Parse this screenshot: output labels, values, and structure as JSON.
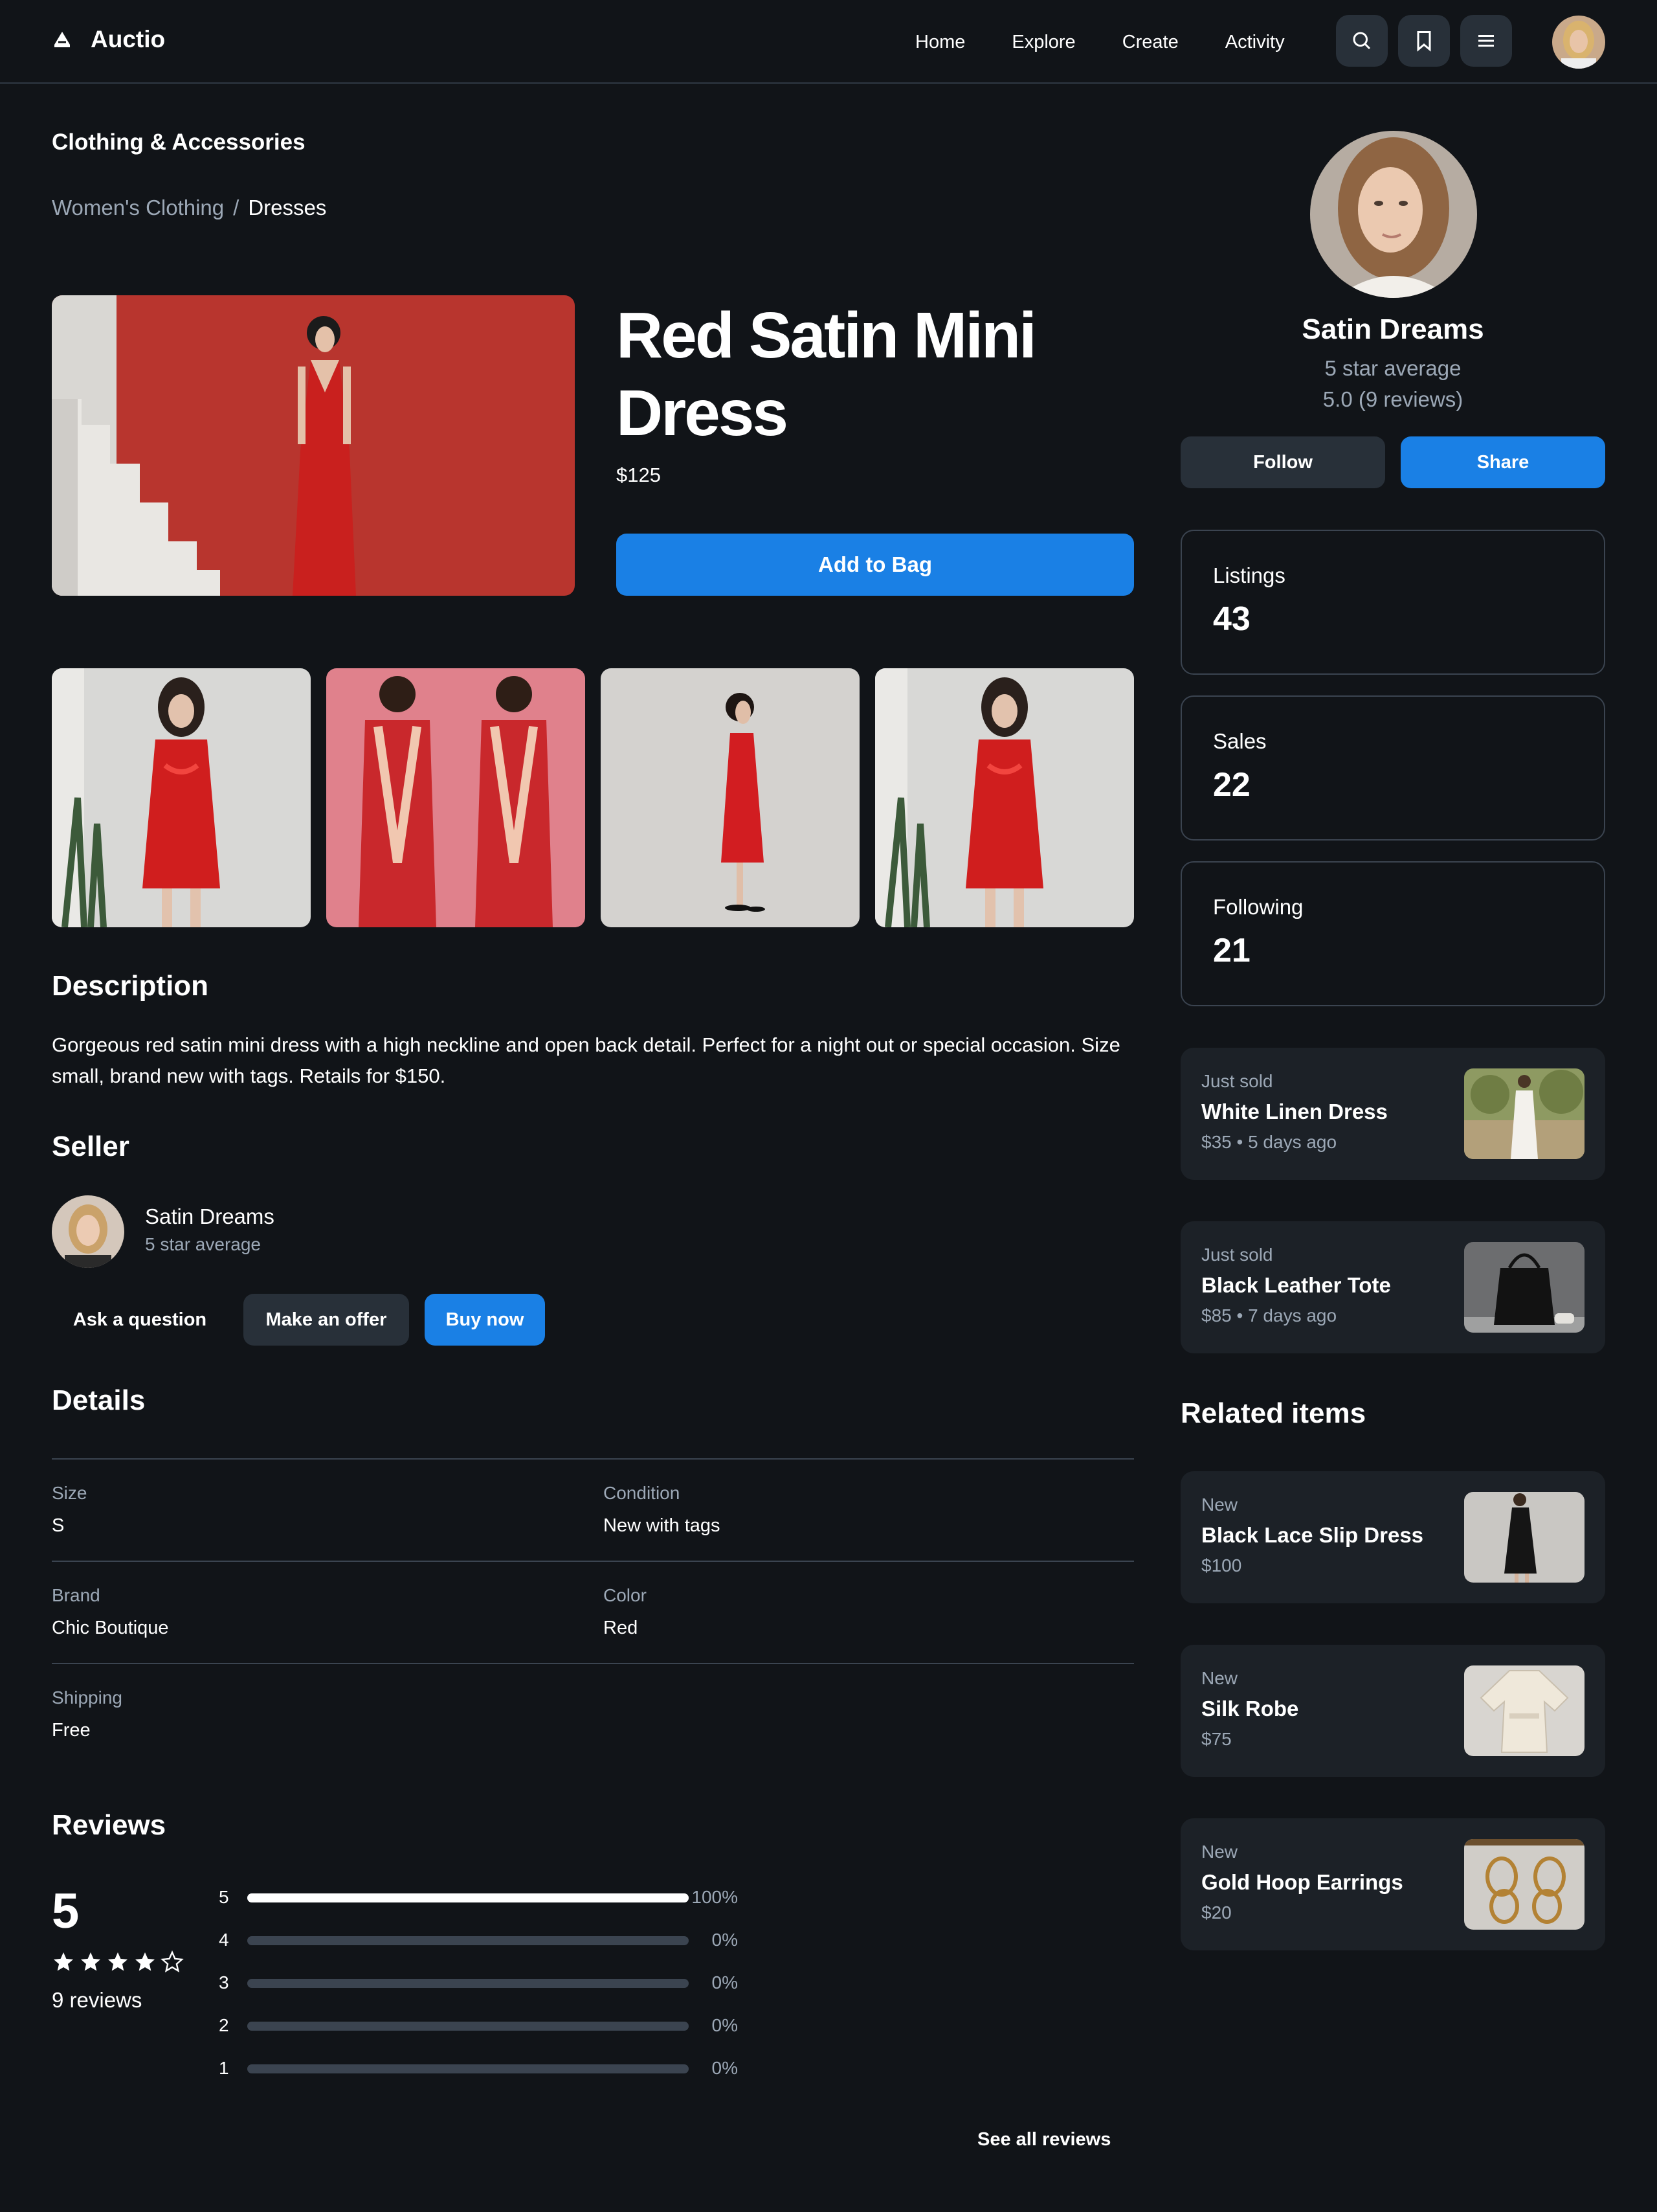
{
  "header": {
    "app_name": "Auctio",
    "nav": [
      "Home",
      "Explore",
      "Create",
      "Activity"
    ]
  },
  "category": "Clothing & Accessories",
  "breadcrumb": {
    "parent": "Women's Clothing",
    "separator": "/",
    "current": "Dresses"
  },
  "product": {
    "title": "Red Satin Mini Dress",
    "price": "$125",
    "add_to_bag": "Add to Bag"
  },
  "description": {
    "heading": "Description",
    "text": "Gorgeous red satin mini dress with a high neckline and open back detail. Perfect for a night out or special occasion. Size small, brand new with tags. Retails for $150."
  },
  "seller": {
    "heading": "Seller",
    "name": "Satin Dreams",
    "rating": "5 star average",
    "ask": "Ask a question",
    "offer": "Make an offer",
    "buy": "Buy now"
  },
  "details": {
    "heading": "Details",
    "size_label": "Size",
    "size": "S",
    "condition_label": "Condition",
    "condition": "New with tags",
    "brand_label": "Brand",
    "brand": "Chic Boutique",
    "color_label": "Color",
    "color": "Red",
    "shipping_label": "Shipping",
    "shipping": "Free"
  },
  "reviews": {
    "heading": "Reviews",
    "score": "5",
    "stars_filled": 4,
    "stars_total": 5,
    "count": "9 reviews",
    "bars": [
      {
        "star": "5",
        "pct": "100%",
        "fill": 1.0
      },
      {
        "star": "4",
        "pct": "0%",
        "fill": 0
      },
      {
        "star": "3",
        "pct": "0%",
        "fill": 0
      },
      {
        "star": "2",
        "pct": "0%",
        "fill": 0
      },
      {
        "star": "1",
        "pct": "0%",
        "fill": 0
      }
    ],
    "see_all": "See all reviews"
  },
  "profile": {
    "name": "Satin Dreams",
    "average": "5 star average",
    "reviews": "5.0 (9 reviews)",
    "follow": "Follow",
    "share": "Share",
    "stats": [
      {
        "label": "Listings",
        "value": "43"
      },
      {
        "label": "Sales",
        "value": "22"
      },
      {
        "label": "Following",
        "value": "21"
      }
    ]
  },
  "sold": [
    {
      "tag": "Just sold",
      "name": "White Linen Dress",
      "meta": "$35 • 5 days ago"
    },
    {
      "tag": "Just sold",
      "name": "Black Leather Tote",
      "meta": "$85 • 7 days ago"
    }
  ],
  "related": {
    "heading": "Related items",
    "items": [
      {
        "tag": "New",
        "name": "Black Lace Slip Dress",
        "meta": "$100"
      },
      {
        "tag": "New",
        "name": "Silk Robe",
        "meta": "$75"
      },
      {
        "tag": "New",
        "name": "Gold Hoop Earrings",
        "meta": "$20"
      }
    ]
  },
  "colors": {
    "accent": "#1a80e5",
    "background": "#111418",
    "surface": "#283039",
    "card": "#1c2127",
    "muted": "#9ca8b6"
  }
}
